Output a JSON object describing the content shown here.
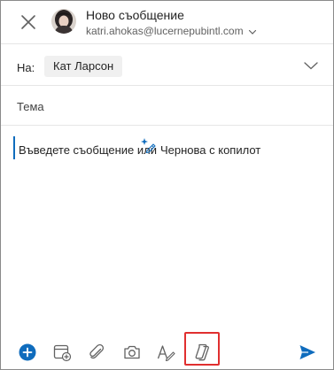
{
  "header": {
    "close_icon": "close-icon",
    "title": "Ново съобщение",
    "account": "katri.ahokas@lucernepubintl.com",
    "account_chevron_icon": "chevron-down-icon"
  },
  "recipients": {
    "to_label": "На:",
    "chips": [
      "Кат Ларсон"
    ],
    "expand_icon": "chevron-down-icon"
  },
  "subject": {
    "placeholder": "Тема"
  },
  "body": {
    "placeholder": "Въведете съобщение или",
    "copilot_icon": "copilot-sparkle-icon",
    "copilot_link": "Чернова с копилот"
  },
  "toolbar": {
    "items": [
      {
        "name": "add-button",
        "icon": "plus-circle-icon"
      },
      {
        "name": "insert-calendar-button",
        "icon": "calendar-add-icon"
      },
      {
        "name": "attach-button",
        "icon": "paperclip-icon"
      },
      {
        "name": "camera-button",
        "icon": "camera-icon"
      },
      {
        "name": "format-text-button",
        "icon": "text-format-icon"
      },
      {
        "name": "copilot-button",
        "icon": "copilot-icon"
      },
      {
        "name": "send-button",
        "icon": "send-icon"
      }
    ]
  },
  "colors": {
    "accent": "#0f6cbd",
    "highlight": "#e02f2f",
    "text": "#242424",
    "muted": "#616161"
  }
}
